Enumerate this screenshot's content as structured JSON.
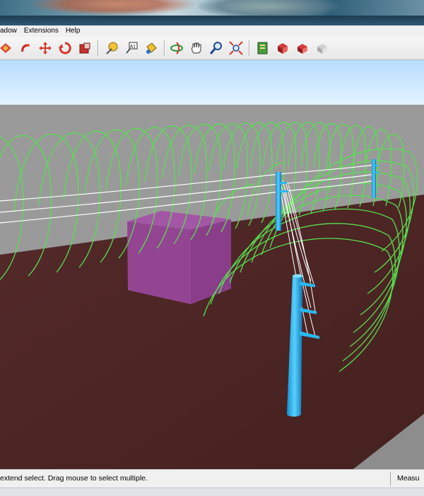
{
  "menu": {
    "items": [
      {
        "label": "adow"
      },
      {
        "label": "Extensions"
      },
      {
        "label": "Help"
      }
    ]
  },
  "toolbar": {
    "groups": [
      [
        "look-around-icon",
        "walk-icon",
        "move-icon",
        "rotate-icon",
        "scale-icon"
      ],
      [
        "tape-measure-icon",
        "text-label-icon",
        "paint-bucket-icon"
      ],
      [
        "orbit-icon",
        "pan-icon",
        "zoom-icon",
        "zoom-extents-icon"
      ],
      [
        "get-models-icon",
        "share-model-icon",
        "get-components-icon",
        "share-component-icon"
      ]
    ]
  },
  "viewport": {
    "sky_color": "#bfe0ff",
    "horizon_color": "#9a9a9a",
    "ground_color": "#4b2626",
    "fence_color": "#55e04a",
    "pole_color": "#21b3f0",
    "box_color": "#974898",
    "wire_color": "#ffffff"
  },
  "status": {
    "hint": "extend select. Drag mouse to select multiple.",
    "measurements_label": "Measu"
  }
}
